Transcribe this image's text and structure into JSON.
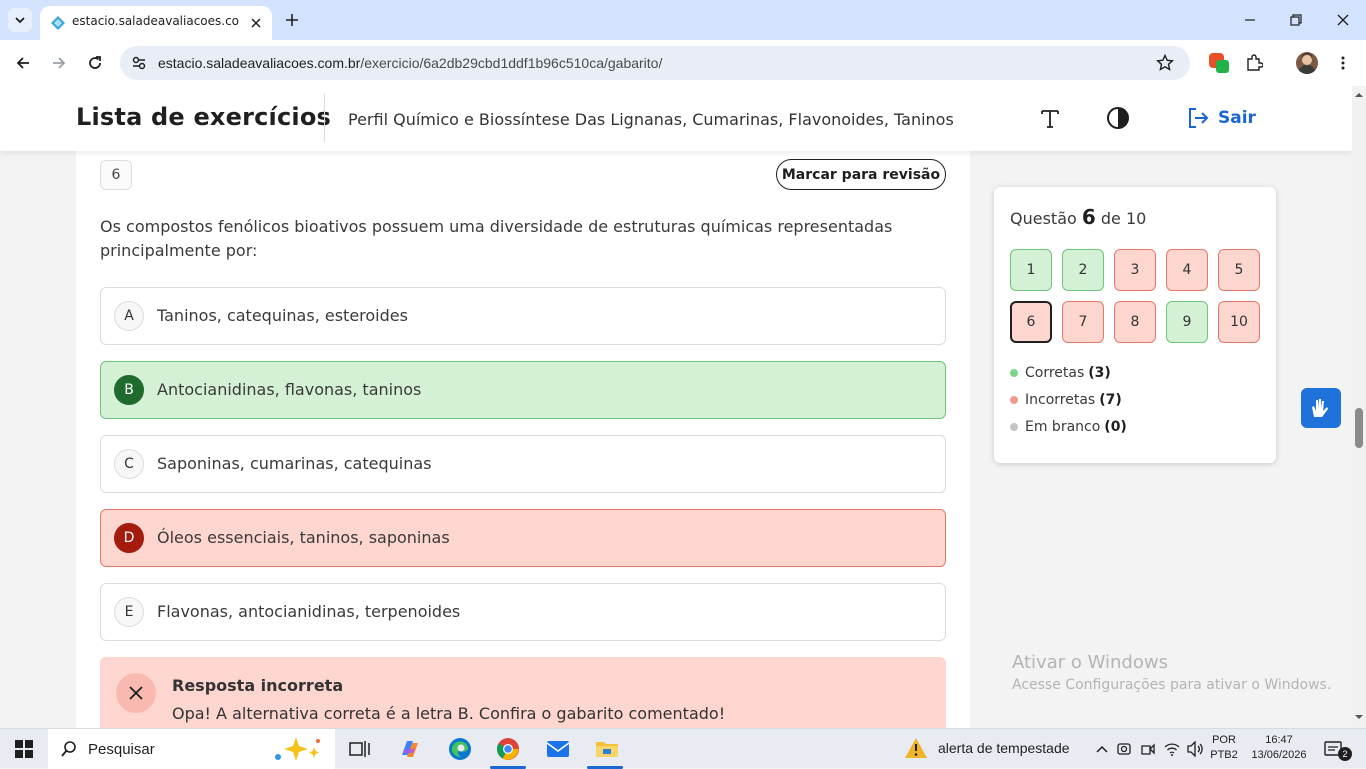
{
  "browser": {
    "tab_title": "estacio.saladeavaliacoes.com.br",
    "url_host": "estacio.saladeavaliacoes.com.br",
    "url_path": "/exercicio/6a2db29cbd1ddf1b96c510ca/gabarito/"
  },
  "header": {
    "title": "Lista de exercícios",
    "subtitle": "Perfil Químico e Biossíntese Das Lignanas, Cumarinas, Flavonoides, Taninos",
    "logout_label": "Sair"
  },
  "question": {
    "number": "6",
    "review_label": "Marcar para revisão",
    "text": "Os compostos fenólicos bioativos possuem uma diversidade de estruturas químicas representadas principalmente por:",
    "options": [
      {
        "letter": "A",
        "text": "Taninos, catequinas, esteroides",
        "state": "neutral"
      },
      {
        "letter": "B",
        "text": "Antocianidinas, flavonas, taninos",
        "state": "correct"
      },
      {
        "letter": "C",
        "text": "Saponinas, cumarinas, catequinas",
        "state": "neutral"
      },
      {
        "letter": "D",
        "text": "Óleos essenciais, taninos, saponinas",
        "state": "wrong"
      },
      {
        "letter": "E",
        "text": "Flavonas, antocianidinas, terpenoides",
        "state": "neutral"
      }
    ]
  },
  "feedback": {
    "title": "Resposta incorreta",
    "text": "Opa! A alternativa correta é a letra B. Confira o gabarito comentado!"
  },
  "sidebar": {
    "label_prefix": "Questão",
    "current": "6",
    "label_suffix": "de 10",
    "questions": [
      {
        "n": "1",
        "status": "ok"
      },
      {
        "n": "2",
        "status": "ok"
      },
      {
        "n": "3",
        "status": "bad"
      },
      {
        "n": "4",
        "status": "bad"
      },
      {
        "n": "5",
        "status": "bad"
      },
      {
        "n": "6",
        "status": "bad"
      },
      {
        "n": "7",
        "status": "bad"
      },
      {
        "n": "8",
        "status": "bad"
      },
      {
        "n": "9",
        "status": "ok"
      },
      {
        "n": "10",
        "status": "bad"
      }
    ],
    "legend": [
      {
        "label": "Corretas",
        "count": "(3)",
        "color": "#7ed487"
      },
      {
        "label": "Incorretas",
        "count": "(7)",
        "color": "#f29a8f"
      },
      {
        "label": "Em branco",
        "count": "(0)",
        "color": "#c4c4c4"
      }
    ]
  },
  "watermark": {
    "line1": "Ativar o Windows",
    "line2": "Acesse Configurações para ativar o Windows."
  },
  "taskbar": {
    "search_label": "Pesquisar",
    "weather_label": "alerta de tempestade",
    "lang_line1": "POR",
    "lang_line2": "PTB2",
    "time": "16:47",
    "date": "13/06/2026",
    "notification_count": "2"
  },
  "colors": {
    "accent": "#1a66d2",
    "correct_bg": "#d4f0d5",
    "wrong_bg": "#fdd6d0"
  }
}
